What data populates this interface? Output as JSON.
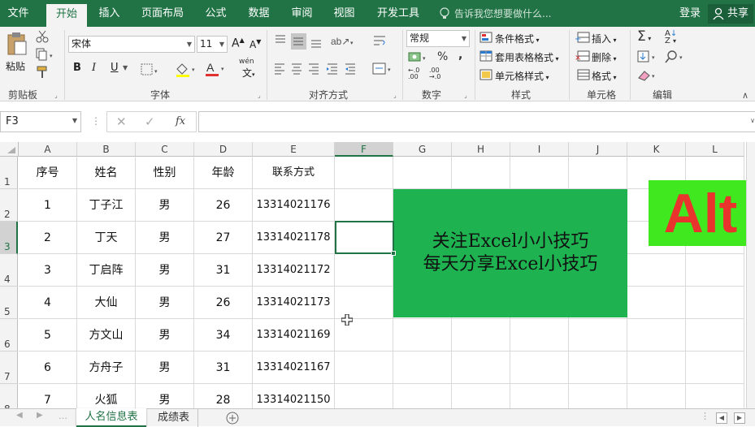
{
  "tabs": [
    {
      "label": "文件",
      "active": false
    },
    {
      "label": "开始",
      "active": true
    },
    {
      "label": "插入",
      "active": false
    },
    {
      "label": "页面布局",
      "active": false
    },
    {
      "label": "公式",
      "active": false
    },
    {
      "label": "数据",
      "active": false
    },
    {
      "label": "审阅",
      "active": false
    },
    {
      "label": "视图",
      "active": false
    },
    {
      "label": "开发工具",
      "active": false
    }
  ],
  "tellme": "告诉我您想要做什么...",
  "login": "登录",
  "share": "共享",
  "ribbon": {
    "paste": "粘贴",
    "clipboard": "剪贴板",
    "font_name": "宋体",
    "font_size": "11",
    "bold": "B",
    "italic": "I",
    "underline": "U",
    "font": "字体",
    "wen": "wén",
    "alignment": "对齐方式",
    "number_format": "常规",
    "percent": "%",
    "comma": ",",
    "number": "数字",
    "cond_format": "条件格式",
    "table_format": "套用表格格式",
    "cell_style": "单元格样式",
    "styles": "样式",
    "insert": "插入",
    "delete": "删除",
    "format": "格式",
    "cells": "单元格",
    "editing": "编辑"
  },
  "formula_bar": {
    "name_box": "F3",
    "fx": "fx",
    "value": ""
  },
  "columns": [
    "A",
    "B",
    "C",
    "D",
    "E",
    "F",
    "G",
    "H",
    "I",
    "J",
    "K",
    "L"
  ],
  "selected_col": "F",
  "selected_row": "3",
  "headers": [
    "序号",
    "姓名",
    "性别",
    "年龄",
    "联系方式"
  ],
  "rows": [
    {
      "num": "2",
      "cells": [
        "1",
        "丁子江",
        "男",
        "26",
        "13314021176"
      ]
    },
    {
      "num": "3",
      "cells": [
        "2",
        "丁天",
        "男",
        "27",
        "13314021178"
      ]
    },
    {
      "num": "4",
      "cells": [
        "3",
        "丁启阵",
        "男",
        "31",
        "13314021172"
      ]
    },
    {
      "num": "5",
      "cells": [
        "4",
        "大仙",
        "男",
        "26",
        "13314021173"
      ]
    },
    {
      "num": "6",
      "cells": [
        "5",
        "方文山",
        "男",
        "34",
        "13314021169"
      ]
    },
    {
      "num": "7",
      "cells": [
        "6",
        "方舟子",
        "男",
        "31",
        "13314021167"
      ]
    },
    {
      "num": "8",
      "cells": [
        "7",
        "火狐",
        "男",
        "28",
        "13314021150"
      ]
    }
  ],
  "banner": {
    "line1": "关注Excel小小技巧",
    "line2": "每天分享Excel小技巧",
    "color": "#1eb350"
  },
  "alt_badge": {
    "text": "Alt",
    "bg": "#3fe81f",
    "fg": "#e8342c"
  },
  "sheets": [
    {
      "label": "人名信息表",
      "active": true
    },
    {
      "label": "成绩表",
      "active": false
    }
  ],
  "accent": "#217346"
}
